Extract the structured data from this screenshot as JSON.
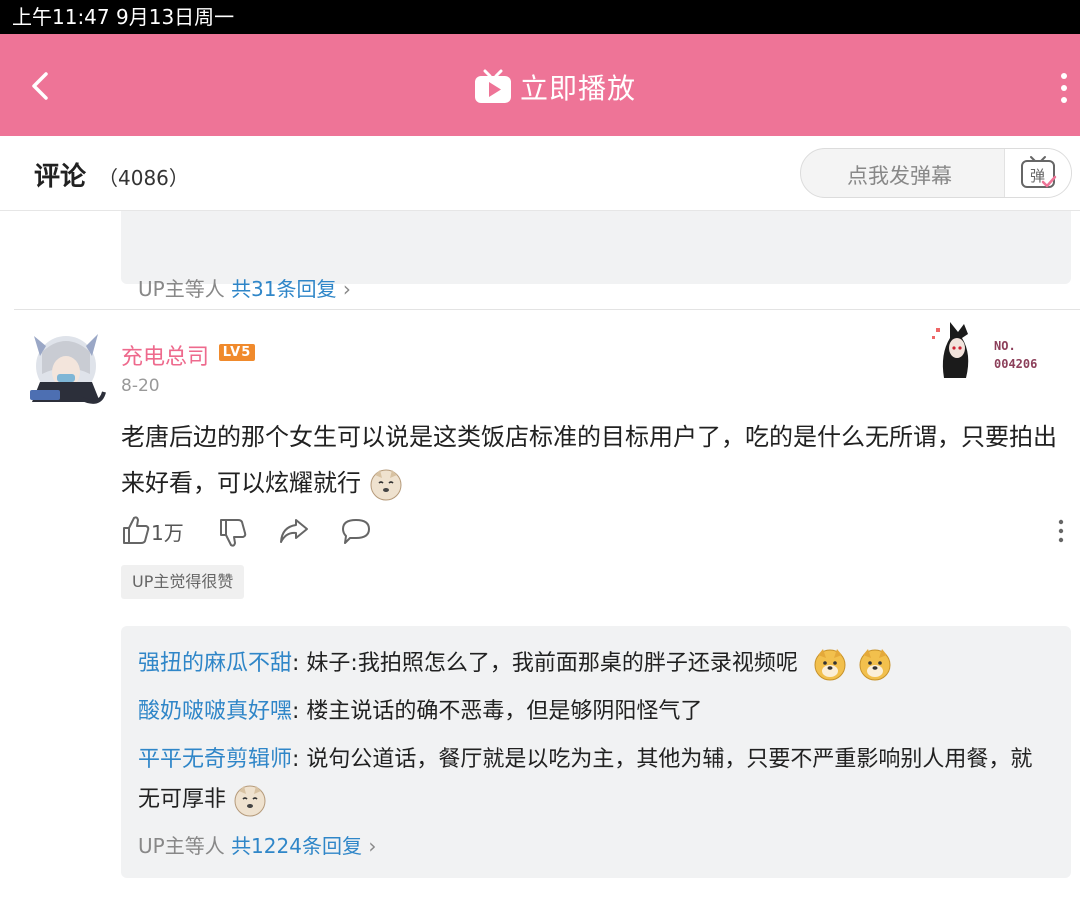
{
  "status_bar": {
    "time_date": "上午11:47   9月13日周一"
  },
  "topbar": {
    "play_label": "立即播放",
    "back_icon": "chevron-left-icon",
    "more_icon": "more-vertical-icon",
    "accent": "#ee7497"
  },
  "comments_header": {
    "title": "评论",
    "count": "（4086）",
    "danmu_placeholder": "点我发弹幕",
    "danmu_button_label": "弹"
  },
  "previous_thread": {
    "reply_meta_prefix": "UP主等人",
    "reply_meta_link": "共31条回复",
    "chevron": "›"
  },
  "comment": {
    "username": "充电总司",
    "level": "LV5",
    "date": "8-20",
    "badge_no": "NO.",
    "badge_id": "004206",
    "text": "老唐后边的那个女生可以说是这类饭店标准的目标用户了，吃的是什么无所谓，只要拍出来好看，可以炫耀就行",
    "like_count": "1万",
    "up_badge": "UP主觉得很赞",
    "replies": [
      {
        "user": "强扭的麻瓜不甜",
        "text": ": 妹子:我拍照怎么了，我前面那桌的胖子还录视频呢"
      },
      {
        "user": "酸奶啵啵真好嘿",
        "text": ": 楼主说话的确不恶毒，但是够阴阳怪气了"
      },
      {
        "user": "平平无奇剪辑师",
        "text": ": 说句公道话，餐厅就是以吃为主，其他为辅，只要不严重影响别人用餐，就无可厚非"
      }
    ],
    "reply_meta_prefix": "UP主等人",
    "reply_meta_link": "共1224条回复",
    "chevron": "›"
  }
}
